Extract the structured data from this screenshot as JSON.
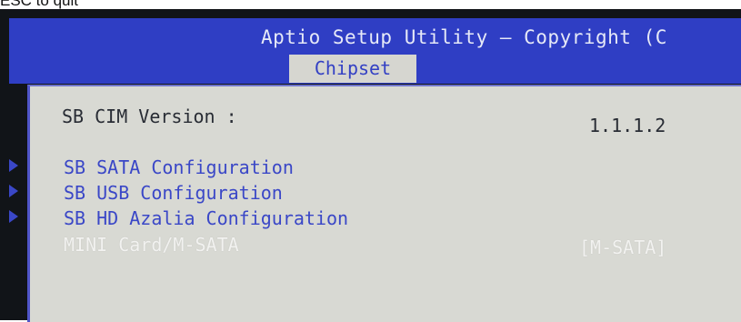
{
  "caption": {
    "text": "ESC to quit"
  },
  "header": {
    "title": "Aptio Setup Utility – Copyright (C",
    "active_tab": "Chipset"
  },
  "info": {
    "label": "SB CIM Version :",
    "value": "1.1.1.2"
  },
  "menu": {
    "items": [
      {
        "label": "SB SATA Configuration"
      },
      {
        "label": "SB USB Configuration"
      },
      {
        "label": "SB HD Azalia Configuration"
      }
    ]
  },
  "option": {
    "label": "MINI Card/M-SATA",
    "value": "[M-SATA]"
  },
  "colors": {
    "header_blue": "#2f3ec4",
    "panel_grey": "#d8d9d3",
    "menu_blue": "#3a47c7"
  }
}
